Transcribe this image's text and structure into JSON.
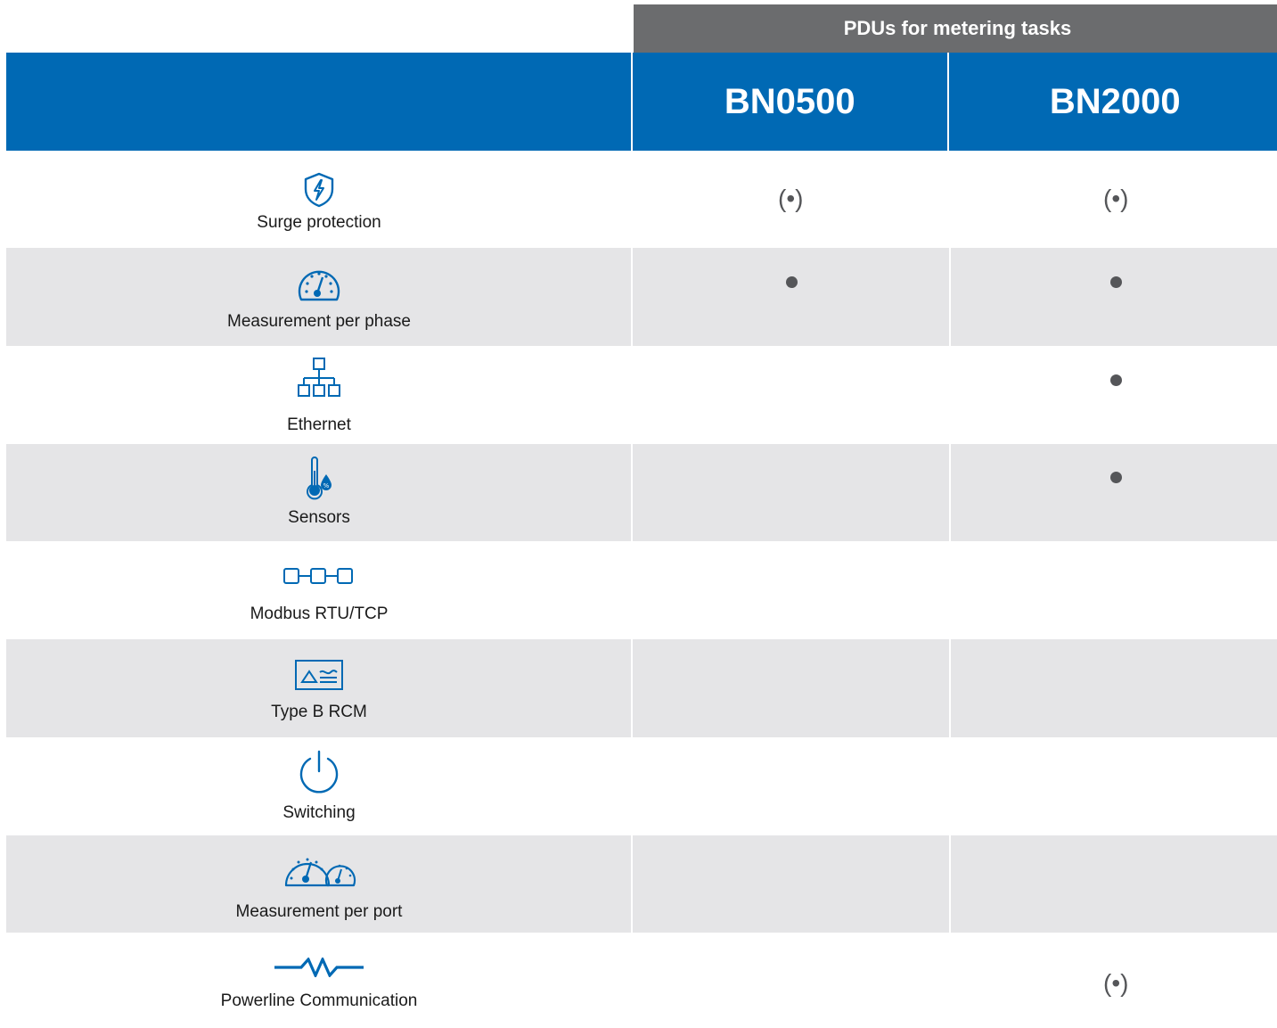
{
  "group_header": "PDUs for metering tasks",
  "models": [
    "BN0500",
    "BN2000"
  ],
  "rows": [
    {
      "label": "Surge protection",
      "icon": "shield-lightning-icon",
      "bn0500": "(•)",
      "bn2000": "(•)"
    },
    {
      "label": "Measurement per phase",
      "icon": "gauge-icon",
      "bn0500": "•",
      "bn2000": "•"
    },
    {
      "label": "Ethernet",
      "icon": "network-tree-icon",
      "bn0500": "",
      "bn2000": "•"
    },
    {
      "label": "Sensors",
      "icon": "thermometer-humidity-icon",
      "bn0500": "",
      "bn2000": "•"
    },
    {
      "label": "Modbus RTU/TCP",
      "icon": "modbus-chain-icon",
      "bn0500": "",
      "bn2000": ""
    },
    {
      "label": "Type B RCM",
      "icon": "rcm-wave-icon",
      "bn0500": "",
      "bn2000": ""
    },
    {
      "label": "Switching",
      "icon": "power-icon",
      "bn0500": "",
      "bn2000": ""
    },
    {
      "label": "Measurement per port",
      "icon": "dual-gauge-icon",
      "bn0500": "",
      "bn2000": ""
    },
    {
      "label": "Powerline Communication",
      "icon": "powerline-icon",
      "bn0500": "",
      "bn2000": "(•)"
    }
  ],
  "colors": {
    "brand_blue": "#0069b4",
    "header_gray": "#6b6c6e",
    "row_shade": "#e5e5e7",
    "mark": "#555659"
  }
}
